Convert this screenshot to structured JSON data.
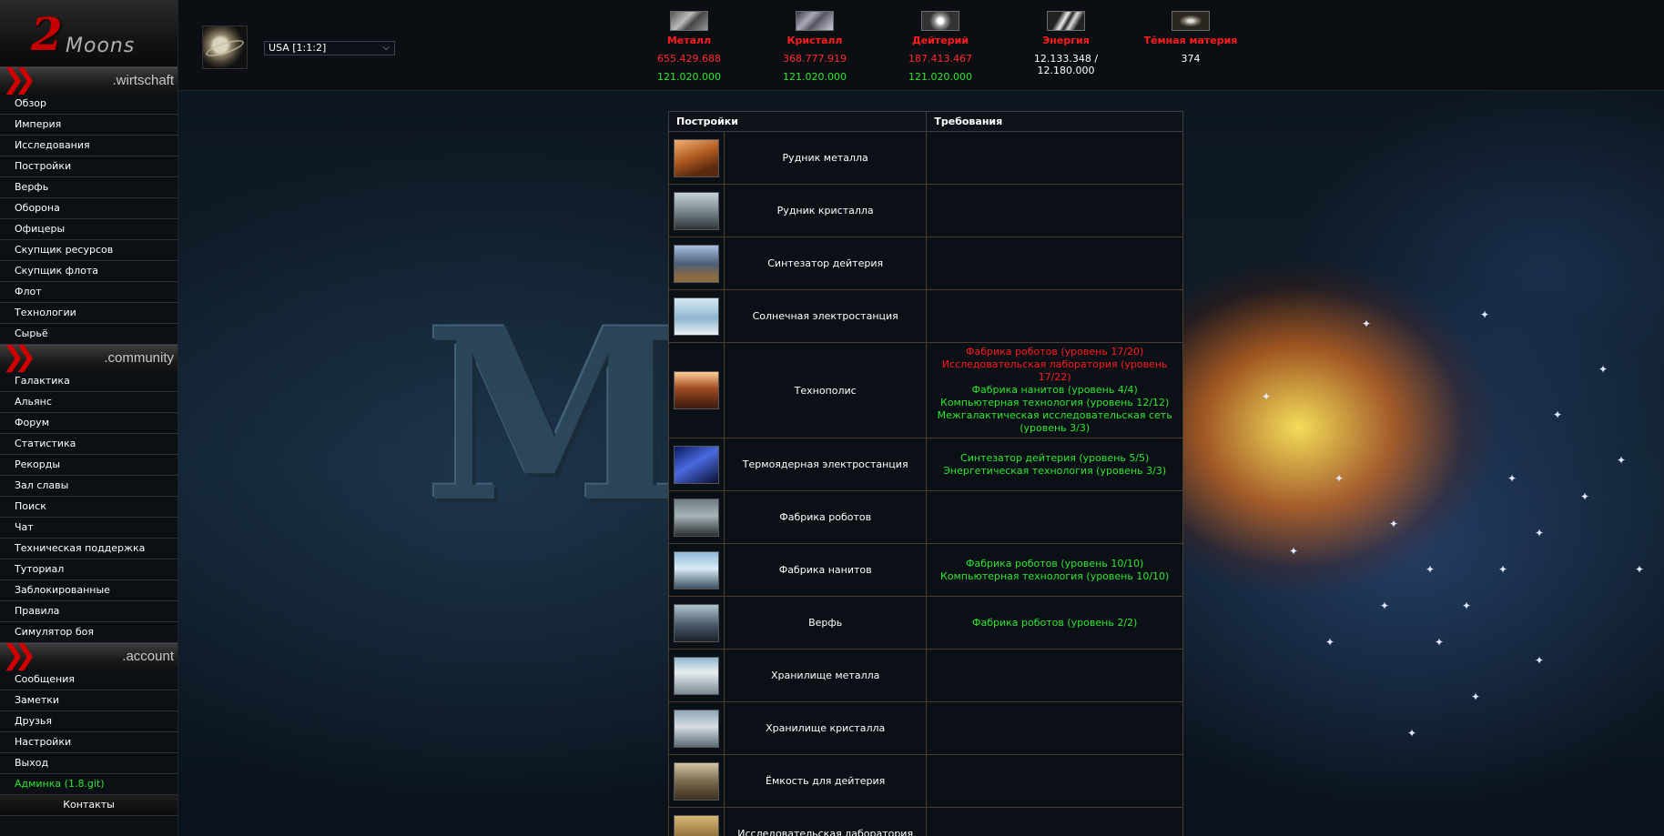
{
  "logo": {
    "number": "2",
    "word": "Moons"
  },
  "sidebar": {
    "sections": [
      {
        "title": ".wirtschaft",
        "items": [
          {
            "label": "Обзор"
          },
          {
            "label": "Империя"
          },
          {
            "label": "Исследования"
          },
          {
            "label": "Постройки"
          },
          {
            "label": "Верфь"
          },
          {
            "label": "Оборона"
          },
          {
            "label": "Офицеры"
          },
          {
            "label": "Скупщик ресурсов"
          },
          {
            "label": "Скупщик флота"
          },
          {
            "label": "Флот"
          },
          {
            "label": "Технологии"
          },
          {
            "label": "Сырьё"
          }
        ]
      },
      {
        "title": ".community",
        "items": [
          {
            "label": "Галактика"
          },
          {
            "label": "Альянс"
          },
          {
            "label": "Форум"
          },
          {
            "label": "Статистика"
          },
          {
            "label": "Рекорды"
          },
          {
            "label": "Зал славы"
          },
          {
            "label": "Поиск"
          },
          {
            "label": "Чат"
          },
          {
            "label": "Техническая поддержка"
          },
          {
            "label": "Туториал"
          },
          {
            "label": "Заблокированные"
          },
          {
            "label": "Правила"
          },
          {
            "label": "Симулятор боя"
          }
        ]
      },
      {
        "title": ".account",
        "items": [
          {
            "label": "Сообщения"
          },
          {
            "label": "Заметки"
          },
          {
            "label": "Друзья"
          },
          {
            "label": "Настройки"
          },
          {
            "label": "Выход"
          },
          {
            "label": "Админка (1.8.git)"
          },
          {
            "label": "Контакты"
          }
        ]
      }
    ]
  },
  "header": {
    "planet_select": "USA [1:1:2]",
    "resources": [
      {
        "name": "Металл",
        "amount": "655.429.688",
        "production": "121.020.000",
        "icon": "metal-icon"
      },
      {
        "name": "Кристалл",
        "amount": "368.777.919",
        "production": "121.020.000",
        "icon": "crystal-icon"
      },
      {
        "name": "Дейтерий",
        "amount": "187.413.467",
        "production": "121.020.000",
        "icon": "deuterium-icon"
      },
      {
        "name": "Энергия",
        "amount": "12.133.348 / 12.180.000",
        "production": "",
        "icon": "energy-icon"
      },
      {
        "name": "Тёмная материя",
        "amount": "374",
        "production": "",
        "icon": "dark-matter-icon"
      }
    ]
  },
  "table": {
    "headers": {
      "buildings": "Постройки",
      "requirements": "Требования"
    },
    "rows": [
      {
        "name": "Рудник металла",
        "requirements": []
      },
      {
        "name": "Рудник кристалла",
        "requirements": []
      },
      {
        "name": "Синтезатор дейтерия",
        "requirements": []
      },
      {
        "name": "Солнечная электростанция",
        "requirements": []
      },
      {
        "name": "Технополис",
        "requirements": [
          {
            "text": "Фабрика роботов (уровень 17/20)",
            "met": false
          },
          {
            "text": "Исследовательская лаборатория (уровень 17/22)",
            "met": false
          },
          {
            "text": "Фабрика нанитов (уровень 4/4)",
            "met": true
          },
          {
            "text": "Компьютерная технология (уровень 12/12)",
            "met": true
          },
          {
            "text": "Межгалактическая исследовательская сеть (уровень 3/3)",
            "met": true
          }
        ]
      },
      {
        "name": "Термоядерная электростанция",
        "requirements": [
          {
            "text": "Синтезатор дейтерия (уровень 5/5)",
            "met": true
          },
          {
            "text": "Энергетическая технология (уровень 3/3)",
            "met": true
          }
        ]
      },
      {
        "name": "Фабрика роботов",
        "requirements": []
      },
      {
        "name": "Фабрика нанитов",
        "requirements": [
          {
            "text": "Фабрика роботов (уровень 10/10)",
            "met": true
          },
          {
            "text": "Компьютерная технология (уровень 10/10)",
            "met": true
          }
        ]
      },
      {
        "name": "Верфь",
        "requirements": [
          {
            "text": "Фабрика роботов (уровень 2/2)",
            "met": true
          }
        ]
      },
      {
        "name": "Хранилище металла",
        "requirements": []
      },
      {
        "name": "Хранилище кристалла",
        "requirements": []
      },
      {
        "name": "Ёмкость для дейтерия",
        "requirements": []
      },
      {
        "name": "Исследовательская лаборатория",
        "requirements": []
      }
    ]
  },
  "colors": {
    "accent_red": "#ff1c1c",
    "met_green": "#2fe62f",
    "unmet_red": "#ff1c1c",
    "logo_red": "#c60000"
  }
}
